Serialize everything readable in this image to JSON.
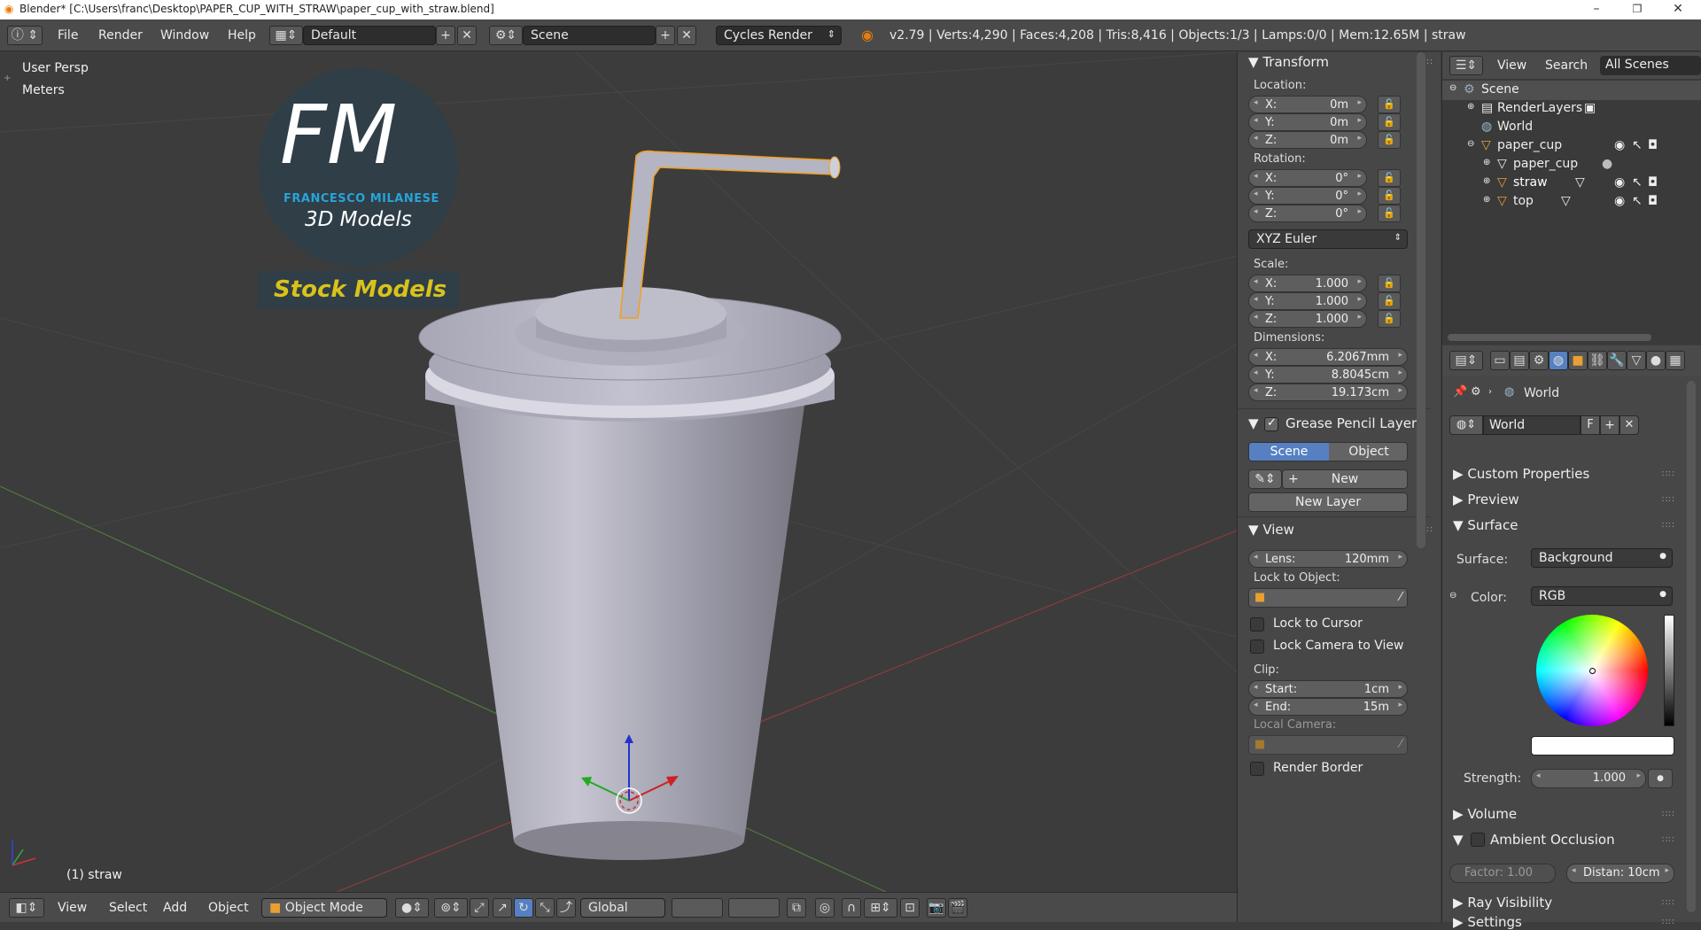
{
  "window": {
    "title": "Blender* [C:\\Users\\franc\\Desktop\\PAPER_CUP_WITH_STRAW\\paper_cup_with_straw.blend]",
    "minimize": "–",
    "maximize": "❐",
    "close": "✕"
  },
  "infobar": {
    "menus": [
      "File",
      "Render",
      "Window",
      "Help"
    ],
    "layout": "Default",
    "scene": "Scene",
    "engine": "Cycles Render",
    "stats": "v2.79 | Verts:4,290 | Faces:4,208 | Tris:8,416 | Objects:1/3 | Lamps:0/0 | Mem:12.65M | straw"
  },
  "viewport": {
    "view_name": "User Persp",
    "units": "Meters",
    "selected_label": "(1) straw",
    "logo": {
      "letters": "FM",
      "brand": "FRANCESCO MILANESE",
      "subtitle": "3D Models",
      "banner": "Stock Models"
    },
    "header": {
      "menus": [
        "View",
        "Select",
        "Add",
        "Object"
      ],
      "mode": "Object Mode",
      "orientation": "Global"
    }
  },
  "npanel": {
    "transform": {
      "title": "Transform",
      "location_label": "Location:",
      "location": [
        {
          "k": "X:",
          "v": "0m"
        },
        {
          "k": "Y:",
          "v": "0m"
        },
        {
          "k": "Z:",
          "v": "0m"
        }
      ],
      "rotation_label": "Rotation:",
      "rotation": [
        {
          "k": "X:",
          "v": "0°"
        },
        {
          "k": "Y:",
          "v": "0°"
        },
        {
          "k": "Z:",
          "v": "0°"
        }
      ],
      "rotation_mode": "XYZ Euler",
      "scale_label": "Scale:",
      "scale": [
        {
          "k": "X:",
          "v": "1.000"
        },
        {
          "k": "Y:",
          "v": "1.000"
        },
        {
          "k": "Z:",
          "v": "1.000"
        }
      ],
      "dimensions_label": "Dimensions:",
      "dimensions": [
        {
          "k": "X:",
          "v": "6.2067mm"
        },
        {
          "k": "Y:",
          "v": "8.8045cm"
        },
        {
          "k": "Z:",
          "v": "19.173cm"
        }
      ]
    },
    "grease_pencil": {
      "title": "Grease Pencil Layer",
      "tab_scene": "Scene",
      "tab_object": "Object",
      "new": "New",
      "new_layer": "New Layer"
    },
    "view": {
      "title": "View",
      "lens_label": "Lens:",
      "lens_value": "120mm",
      "lock_to_object": "Lock to Object:",
      "lock_to_cursor": "Lock to Cursor",
      "lock_camera": "Lock Camera to View",
      "clip_label": "Clip:",
      "clip_start_label": "Start:",
      "clip_start": "1cm",
      "clip_end_label": "End:",
      "clip_end": "15m",
      "local_camera": "Local Camera:",
      "render_border": "Render Border"
    }
  },
  "outliner": {
    "menus": [
      "View",
      "Search"
    ],
    "scope": "All Scenes",
    "items": [
      {
        "label": "Scene",
        "depth": 0
      },
      {
        "label": "RenderLayers",
        "depth": 1
      },
      {
        "label": "World",
        "depth": 1
      },
      {
        "label": "paper_cup",
        "depth": 1
      },
      {
        "label": "paper_cup",
        "depth": 2
      },
      {
        "label": "straw",
        "depth": 2
      },
      {
        "label": "top",
        "depth": 2
      }
    ]
  },
  "properties": {
    "context_world": "World",
    "world_name": "World",
    "fake_user": "F",
    "sections": {
      "custom_properties": "Custom Properties",
      "preview": "Preview",
      "surface": "Surface",
      "volume": "Volume",
      "ambient_occlusion": "Ambient Occlusion",
      "ray_visibility": "Ray Visibility",
      "settings": "Settings"
    },
    "surface_label": "Surface:",
    "surface_value": "Background",
    "color_label": "Color:",
    "color_value": "RGB",
    "strength_label": "Strength:",
    "strength_value": "1.000",
    "ao_factor": "Factor: 1.00",
    "ao_distance": "Distan: 10cm"
  },
  "colors": {
    "accent": "#5680c2",
    "viewport_bg": "#3c3c3c",
    "panel_bg": "#474747",
    "logo_blue": "#29a3d8",
    "logo_yellow": "#d9c21b",
    "selection_orange": "#f0a020"
  }
}
